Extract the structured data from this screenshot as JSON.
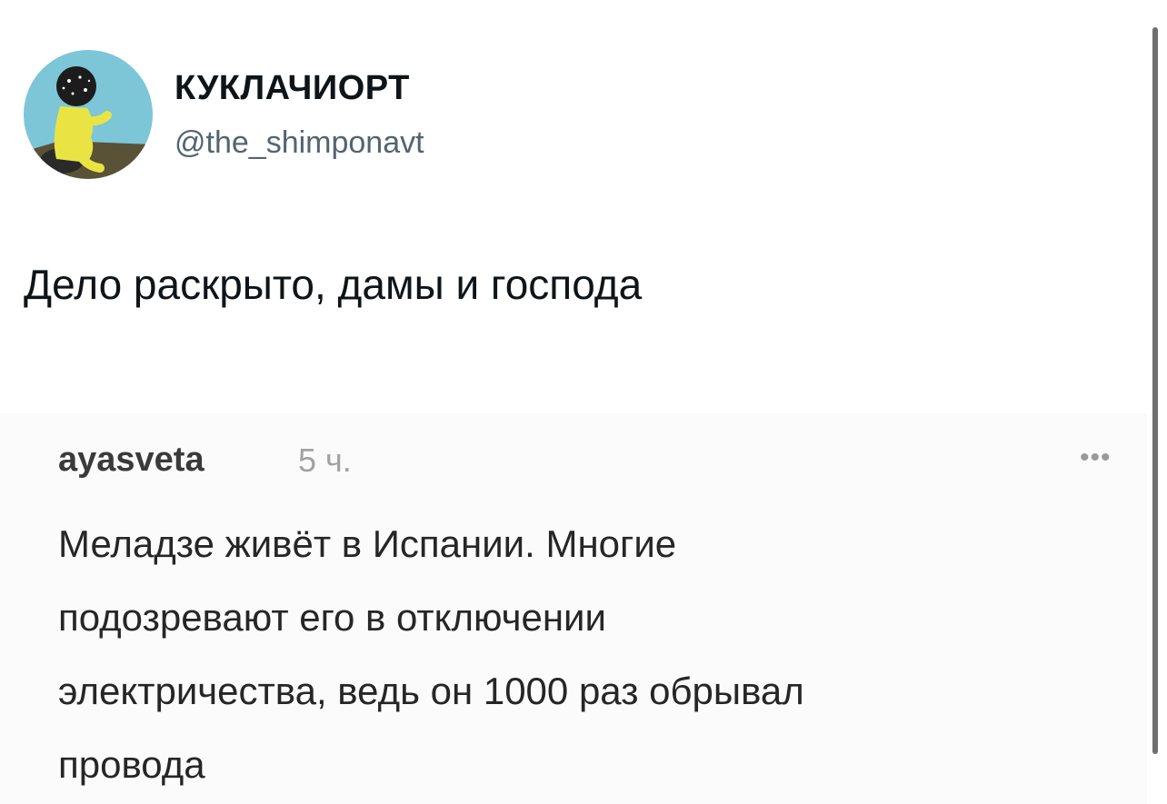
{
  "tweet": {
    "display_name": "КУКЛАЧИОРТ",
    "handle": "@the_shimponavt",
    "avatar_icon": "avatar-illustration",
    "text": "Дело раскрыто, дамы и господа"
  },
  "comment": {
    "username": "ayasveta",
    "time": "5 ч.",
    "more_icon": "more-dots-icon",
    "lines": [
      "Меладзе живёт в Испании. Многие",
      "подозревают его в отключении",
      "электричества, ведь он 1000 раз обрывал",
      "провода"
    ]
  },
  "colors": {
    "avatar_bg": "#7cc6d8",
    "handle": "#536471",
    "comment_time": "#a2a2a2"
  }
}
